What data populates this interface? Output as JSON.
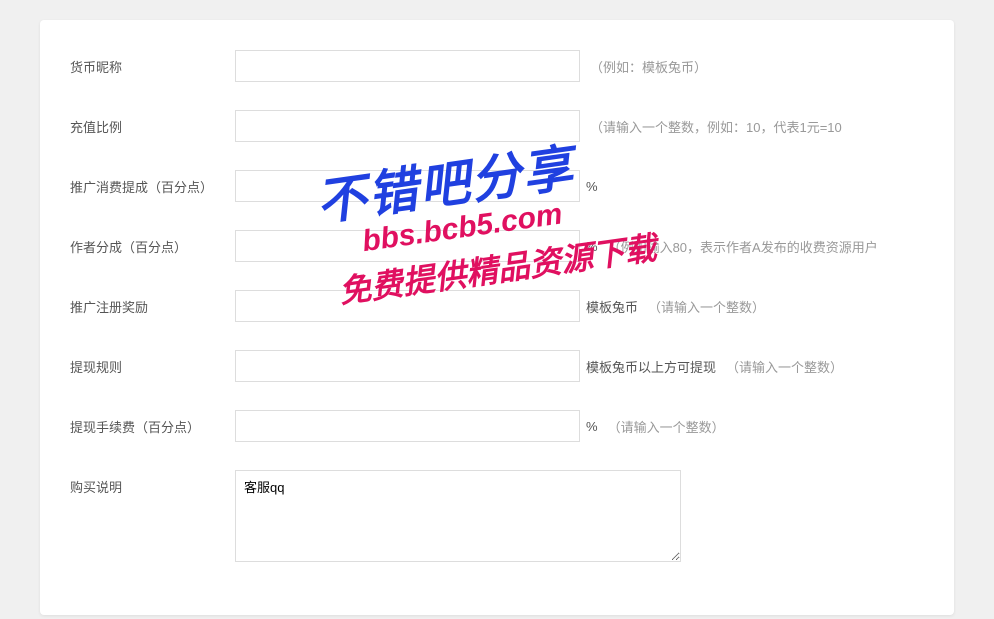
{
  "form": {
    "currency_nick": {
      "label": "货币昵称",
      "value": "",
      "hint": "（例如：模板兔币）"
    },
    "recharge_ratio": {
      "label": "充值比例",
      "value": "",
      "hint": "（请输入一个整数，例如：10，代表1元=10"
    },
    "promo_consume_cut": {
      "label": "推广消费提成（百分点）",
      "value": "",
      "suffix": "%"
    },
    "author_cut": {
      "label": "作者分成（百分点）",
      "value": "",
      "suffix": "%",
      "hint": "（例如输入80，表示作者A发布的收费资源用户"
    },
    "promo_reg_reward": {
      "label": "推广注册奖励",
      "value": "",
      "suffix": "模板兔币",
      "hint": "（请输入一个整数）"
    },
    "withdraw_rule": {
      "label": "提现规则",
      "value": "",
      "suffix": "模板兔币以上方可提现",
      "hint": "（请输入一个整数）"
    },
    "withdraw_fee": {
      "label": "提现手续费（百分点）",
      "value": "",
      "suffix": "%",
      "hint": "（请输入一个整数）"
    },
    "purchase_note": {
      "label": "购买说明",
      "value": "客服qq"
    }
  },
  "watermark": {
    "line1": "不错吧分享",
    "line2": "bbs.bcb5.com",
    "line3": "免费提供精品资源下载"
  }
}
